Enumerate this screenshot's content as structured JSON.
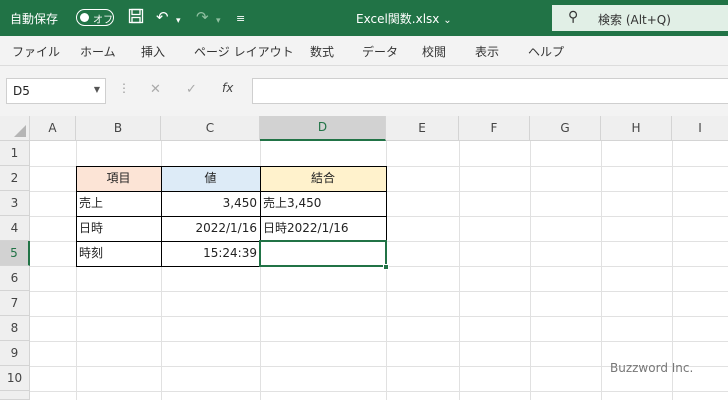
{
  "titlebar": {
    "autosave_label": "自動保存",
    "autosave_state": "オフ",
    "filename": "Excel関数.xlsx",
    "filename_chevron": "⌄",
    "search_label": "検索 (Alt+Q)",
    "bg_color": "#217346"
  },
  "ribbon": {
    "tabs": [
      "ファイル",
      "ホーム",
      "挿入",
      "ページ レイアウト",
      "数式",
      "データ",
      "校閲",
      "表示",
      "ヘルプ"
    ]
  },
  "formula_bar": {
    "name_box": "D5",
    "cancel_glyph": "✕",
    "enter_glyph": "✓",
    "fx_label": "fx",
    "value": ""
  },
  "sheet": {
    "columns": [
      "A",
      "B",
      "C",
      "D",
      "E",
      "F",
      "G",
      "H",
      "I"
    ],
    "rows": [
      "1",
      "2",
      "3",
      "4",
      "5",
      "6",
      "7",
      "8",
      "9",
      "10"
    ],
    "selected_column": "D",
    "selected_row": "5",
    "table": {
      "header": {
        "item": "項目",
        "value": "値",
        "combined": "結合"
      },
      "header_colors": {
        "item": "#fce4d6",
        "value": "#ddebf7",
        "combined": "#fff2cc"
      },
      "rows": [
        {
          "item": "売上",
          "value": "3,450",
          "combined": "売上3,450"
        },
        {
          "item": "日時",
          "value": "2022/1/16",
          "combined": "日時2022/1/16"
        },
        {
          "item": "時刻",
          "value": "15:24:39",
          "combined": ""
        }
      ]
    }
  },
  "watermark": "Buzzword Inc."
}
